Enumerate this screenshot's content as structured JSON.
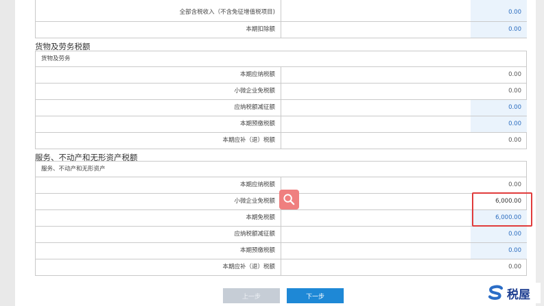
{
  "top_rows": [
    {
      "label": "全部含税收入（不含免征增值税项目)",
      "value": "0.00"
    },
    {
      "label": "本期扣除额",
      "value": "0.00"
    }
  ],
  "goods_section": {
    "title": "货物及劳务税额",
    "subheading": "货物及劳务",
    "rows": [
      {
        "label": "本期应纳税额",
        "value": "0.00"
      },
      {
        "label": "小微企业免税额",
        "value": "0.00"
      },
      {
        "label": "应纳税额减征额",
        "value": "0.00"
      },
      {
        "label": "本期预缴税额",
        "value": "0.00"
      },
      {
        "label": "本期应补（退）税额",
        "value": "0.00"
      }
    ]
  },
  "services_section": {
    "title": "服务、不动产和无形资产税额",
    "subheading": "服务、不动产和无形资产",
    "rows": [
      {
        "label": "本期应纳税额",
        "value": "0.00"
      },
      {
        "label": "小微企业免税额",
        "value": "6,000.00"
      },
      {
        "label": "本期免税额",
        "value": "6,000.00"
      },
      {
        "label": "应纳税额减征额",
        "value": "0.00"
      },
      {
        "label": "本期预缴税额",
        "value": "0.00"
      },
      {
        "label": "本期应补（退）税额",
        "value": "0.00"
      }
    ]
  },
  "buttons": {
    "prev": "上一步",
    "next": "下一步"
  },
  "logo": {
    "text": "税屋"
  },
  "colors": {
    "accent": "#1e88d6",
    "highlight": "#e03a3a",
    "editable_bg": "#eaf3fc"
  },
  "icons": {
    "search": "search-icon",
    "logo": "s-logo-icon"
  }
}
